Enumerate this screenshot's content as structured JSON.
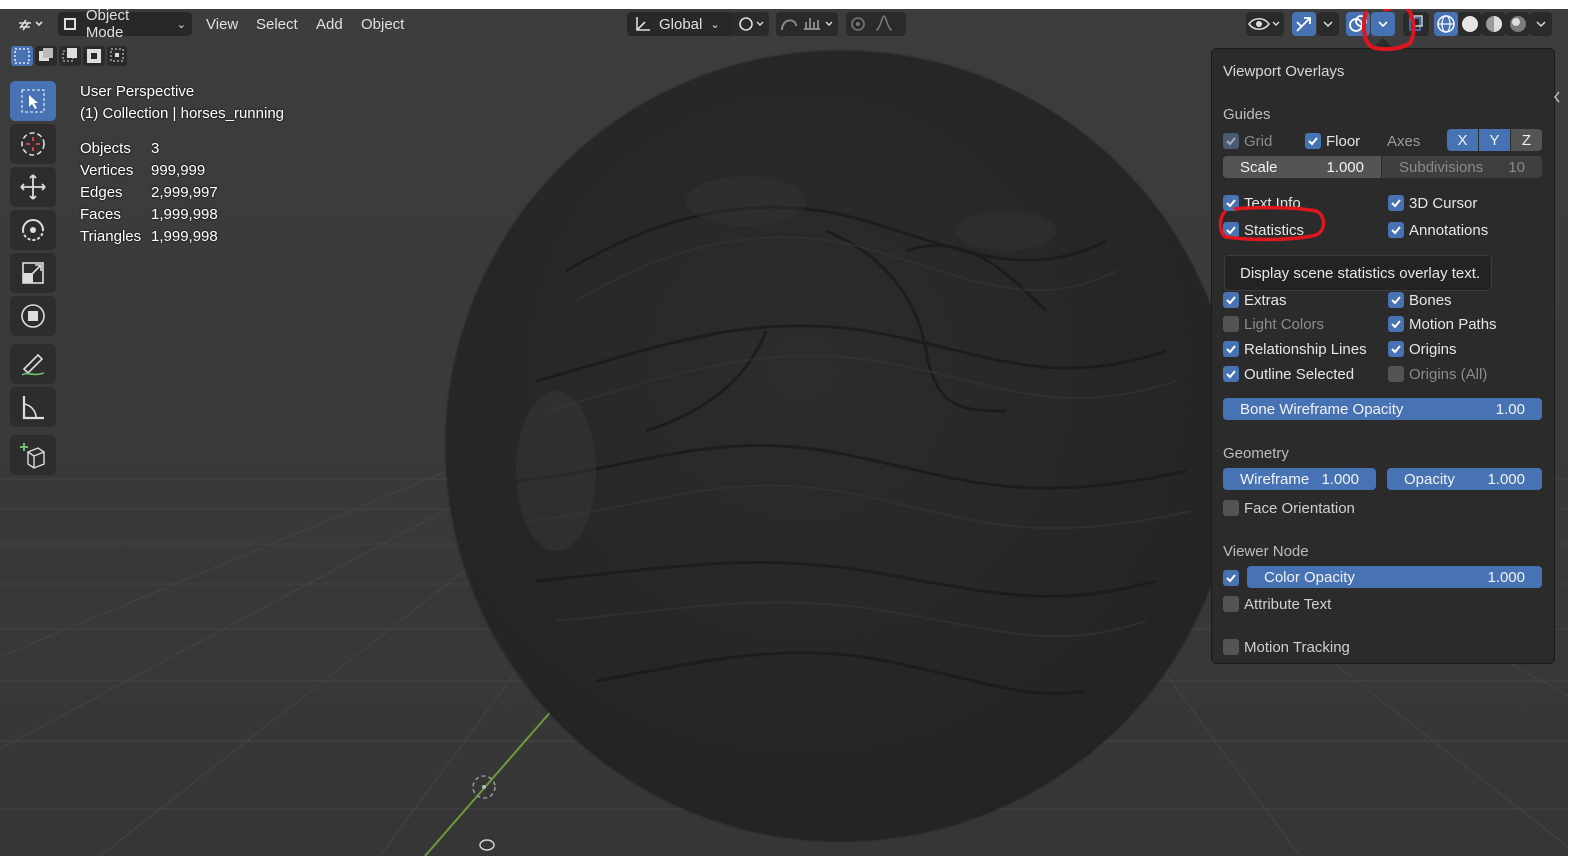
{
  "header": {
    "mode": "Object Mode",
    "menus": [
      "View",
      "Select",
      "Add",
      "Object"
    ],
    "orientation": "Global"
  },
  "stats": {
    "perspective": "User Perspective",
    "collection": "(1) Collection | horses_running",
    "rows": [
      {
        "label": "Objects",
        "value": "3"
      },
      {
        "label": "Vertices",
        "value": "999,999"
      },
      {
        "label": "Edges",
        "value": "2,999,997"
      },
      {
        "label": "Faces",
        "value": "1,999,998"
      },
      {
        "label": "Triangles",
        "value": "1,999,998"
      }
    ]
  },
  "panel": {
    "title": "Viewport Overlays",
    "guides": {
      "section": "Guides",
      "grid": "Grid",
      "floor": "Floor",
      "axes": "Axes",
      "axis_x": "X",
      "axis_y": "Y",
      "axis_z": "Z",
      "scale_label": "Scale",
      "scale_value": "1.000",
      "subdivisions_label": "Subdivisions",
      "subdivisions_value": "10",
      "text_info": "Text Info",
      "cursor_3d": "3D Cursor",
      "statistics": "Statistics",
      "annotations": "Annotations"
    },
    "tooltip": "Display scene statistics overlay text.",
    "objects": {
      "extras": "Extras",
      "bones": "Bones",
      "light_colors": "Light Colors",
      "motion_paths": "Motion Paths",
      "relationship_lines": "Relationship Lines",
      "origins": "Origins",
      "outline_selected": "Outline Selected",
      "origins_all": "Origins (All)",
      "bone_wireframe_label": "Bone Wireframe Opacity",
      "bone_wireframe_value": "1.00"
    },
    "geometry": {
      "section": "Geometry",
      "wireframe_label": "Wireframe",
      "wireframe_value": "1.000",
      "opacity_label": "Opacity",
      "opacity_value": "1.000",
      "face_orientation": "Face Orientation"
    },
    "viewer_node": {
      "section": "Viewer Node",
      "color_opacity_label": "Color Opacity",
      "color_opacity_value": "1.000",
      "attribute_text": "Attribute Text"
    },
    "motion_tracking": "Motion Tracking"
  },
  "colors": {
    "accent": "#4772b3",
    "panel_bg": "#2b2b2b",
    "annotation_red": "#e0161e"
  }
}
